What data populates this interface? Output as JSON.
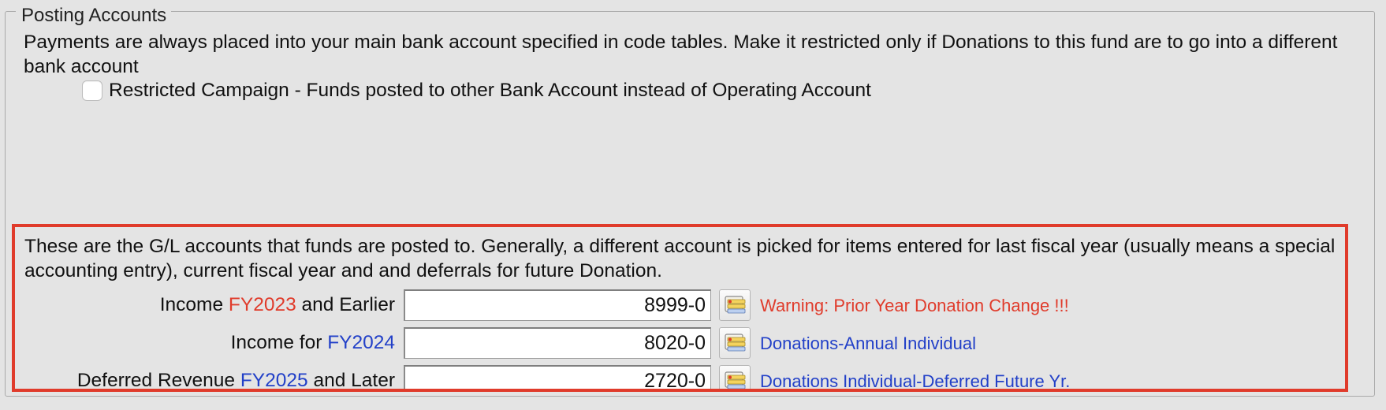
{
  "group": {
    "title": "Posting Accounts"
  },
  "intro_text": "Payments are always placed into your main bank account specified in code tables.  Make it restricted only if Donations to this fund are to go into a different bank account",
  "restricted_checkbox": {
    "label": "Restricted Campaign - Funds posted to other Bank Account instead of Operating Account",
    "checked": false
  },
  "gl_section": {
    "description": "These are the G/L accounts that funds are posted to.  Generally, a different account is picked for items entered for last fiscal year (usually means a special accounting entry), current fiscal year and and deferrals for future Donation.",
    "highlight_color": "#e03b2b",
    "rows": [
      {
        "label_prefix": "Income ",
        "fiscal_year": "FY2023",
        "fiscal_year_color": "red",
        "label_suffix": " and Earlier",
        "account": "8999-0",
        "lookup_icon": "folder-list-icon",
        "description": "Warning: Prior Year Donation Change !!!",
        "description_color": "red"
      },
      {
        "label_prefix": "Income for ",
        "fiscal_year": "FY2024",
        "fiscal_year_color": "blue",
        "label_suffix": "",
        "account": "8020-0",
        "lookup_icon": "folder-list-icon",
        "description": "Donations-Annual Individual",
        "description_color": "blue"
      },
      {
        "label_prefix": "Deferred Revenue ",
        "fiscal_year": "FY2025",
        "fiscal_year_color": "blue",
        "label_suffix": " and Later",
        "account": "2720-0",
        "lookup_icon": "folder-list-icon",
        "description": "Donations Individual-Deferred Future Yr.",
        "description_color": "blue"
      }
    ]
  },
  "colors": {
    "red": "#e03b2b",
    "blue": "#2240c8"
  }
}
